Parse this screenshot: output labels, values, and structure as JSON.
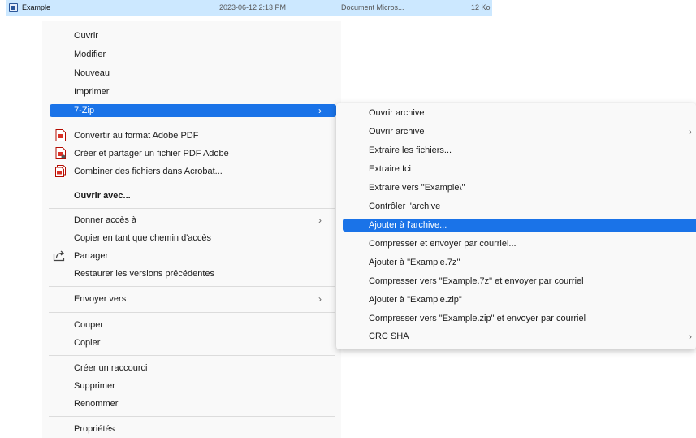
{
  "file_row": {
    "name": "Example",
    "date": "2023-06-12 2:13 PM",
    "type": "Document Micros...",
    "size": "12 Ko"
  },
  "menu": {
    "open": "Ouvrir",
    "edit": "Modifier",
    "new": "Nouveau",
    "print": "Imprimer",
    "sevenzip": "7-Zip",
    "convert_pdf": "Convertir au format Adobe PDF",
    "share_pdf": "Créer et partager un fichier PDF Adobe",
    "combine_pdf": "Combiner des fichiers dans Acrobat...",
    "open_with": "Ouvrir avec...",
    "give_access": "Donner accès à",
    "copy_path": "Copier en tant que chemin d'accès",
    "share": "Partager",
    "restore": "Restaurer les versions précédentes",
    "send_to": "Envoyer vers",
    "cut": "Couper",
    "copy": "Copier",
    "shortcut": "Créer un raccourci",
    "delete": "Supprimer",
    "rename": "Renommer",
    "properties": "Propriétés"
  },
  "submenu": {
    "open_archive_1": "Ouvrir archive",
    "open_archive_2": "Ouvrir archive",
    "extract_files": "Extraire les fichiers...",
    "extract_here": "Extraire Ici",
    "extract_to": "Extraire vers \"Example\\\"",
    "test_archive": "Contrôler l'archive",
    "add_to_archive": "Ajouter à l'archive...",
    "compress_email": "Compresser et envoyer par courriel...",
    "add_7z": "Ajouter à \"Example.7z\"",
    "compress_7z_email": "Compresser vers \"Example.7z\" et envoyer par courriel",
    "add_zip": "Ajouter à \"Example.zip\"",
    "compress_zip_email": "Compresser vers \"Example.zip\" et envoyer par courriel",
    "crc_sha": "CRC SHA"
  },
  "icons": {
    "chevron": "›",
    "pdf": "adobe-pdf-icon",
    "share": "share-icon",
    "file": "word-document-icon"
  },
  "colors": {
    "highlight": "#1a73e8",
    "selected_row": "#cce8ff",
    "menu_bg": "#f9f9f9"
  }
}
